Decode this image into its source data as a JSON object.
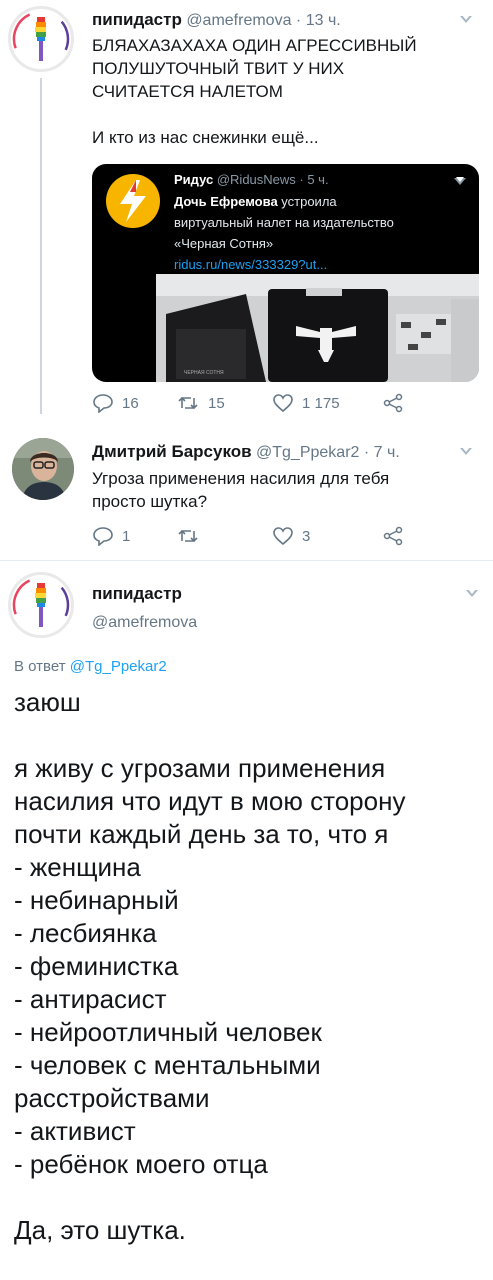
{
  "tweet1": {
    "display_name": "пипидастр",
    "handle_time": "@amefremova · 13 ч.",
    "text_lines": [
      "БЛЯАХАЗАХАХА ОДИН АГРЕССИВНЫЙ",
      "ПОЛУШУТОЧНЫЙ ТВИТ У НИХ",
      "СЧИТАЕТСЯ НАЛЕТОМ"
    ],
    "text_line2": "И кто из нас снежинки ещё...",
    "quote": {
      "display_name": "Ридус",
      "handle_time": "@RidusNews · 5 ч.",
      "title": "Дочь Ефремова",
      "text_rest": " устроила",
      "text_lines": [
        "виртуальный налет на издательство",
        "«Черная Сотня»"
      ],
      "link": "ridus.ru/news/333329?ut..."
    },
    "actions": {
      "replies": "16",
      "retweets": "15",
      "likes": "1 175"
    }
  },
  "tweet2": {
    "display_name": "Дмитрий Барсуков",
    "handle_time": "@Tg_Ppekar2 · 7 ч.",
    "text_lines": [
      "Угроза применения насилия для тебя",
      "просто шутка?"
    ],
    "actions": {
      "replies": "1",
      "retweets": "",
      "likes": "3"
    }
  },
  "tweet3": {
    "display_name": "пипидастр",
    "handle": "@amefremova",
    "reply_prefix": "В ответ ",
    "reply_to": "@Tg_Ppekar2",
    "lines": [
      "заюш",
      "",
      "я живу с угрозами применения",
      "насилия что идут в мою сторону",
      "почти каждый день за то, что я",
      "- женщина",
      "- небинарный",
      "- лесбиянка",
      "- феминистка",
      "- антирасист",
      "- нейроотличный человек",
      "- человек с ментальными",
      "расстройствами",
      "- активист",
      "- ребёнок моего отца",
      "",
      "Да, это шутка."
    ]
  },
  "colors": {
    "link": "#1da1f2",
    "muted": "#657786",
    "text": "#14171a",
    "quote_link": "#1da1f2"
  }
}
